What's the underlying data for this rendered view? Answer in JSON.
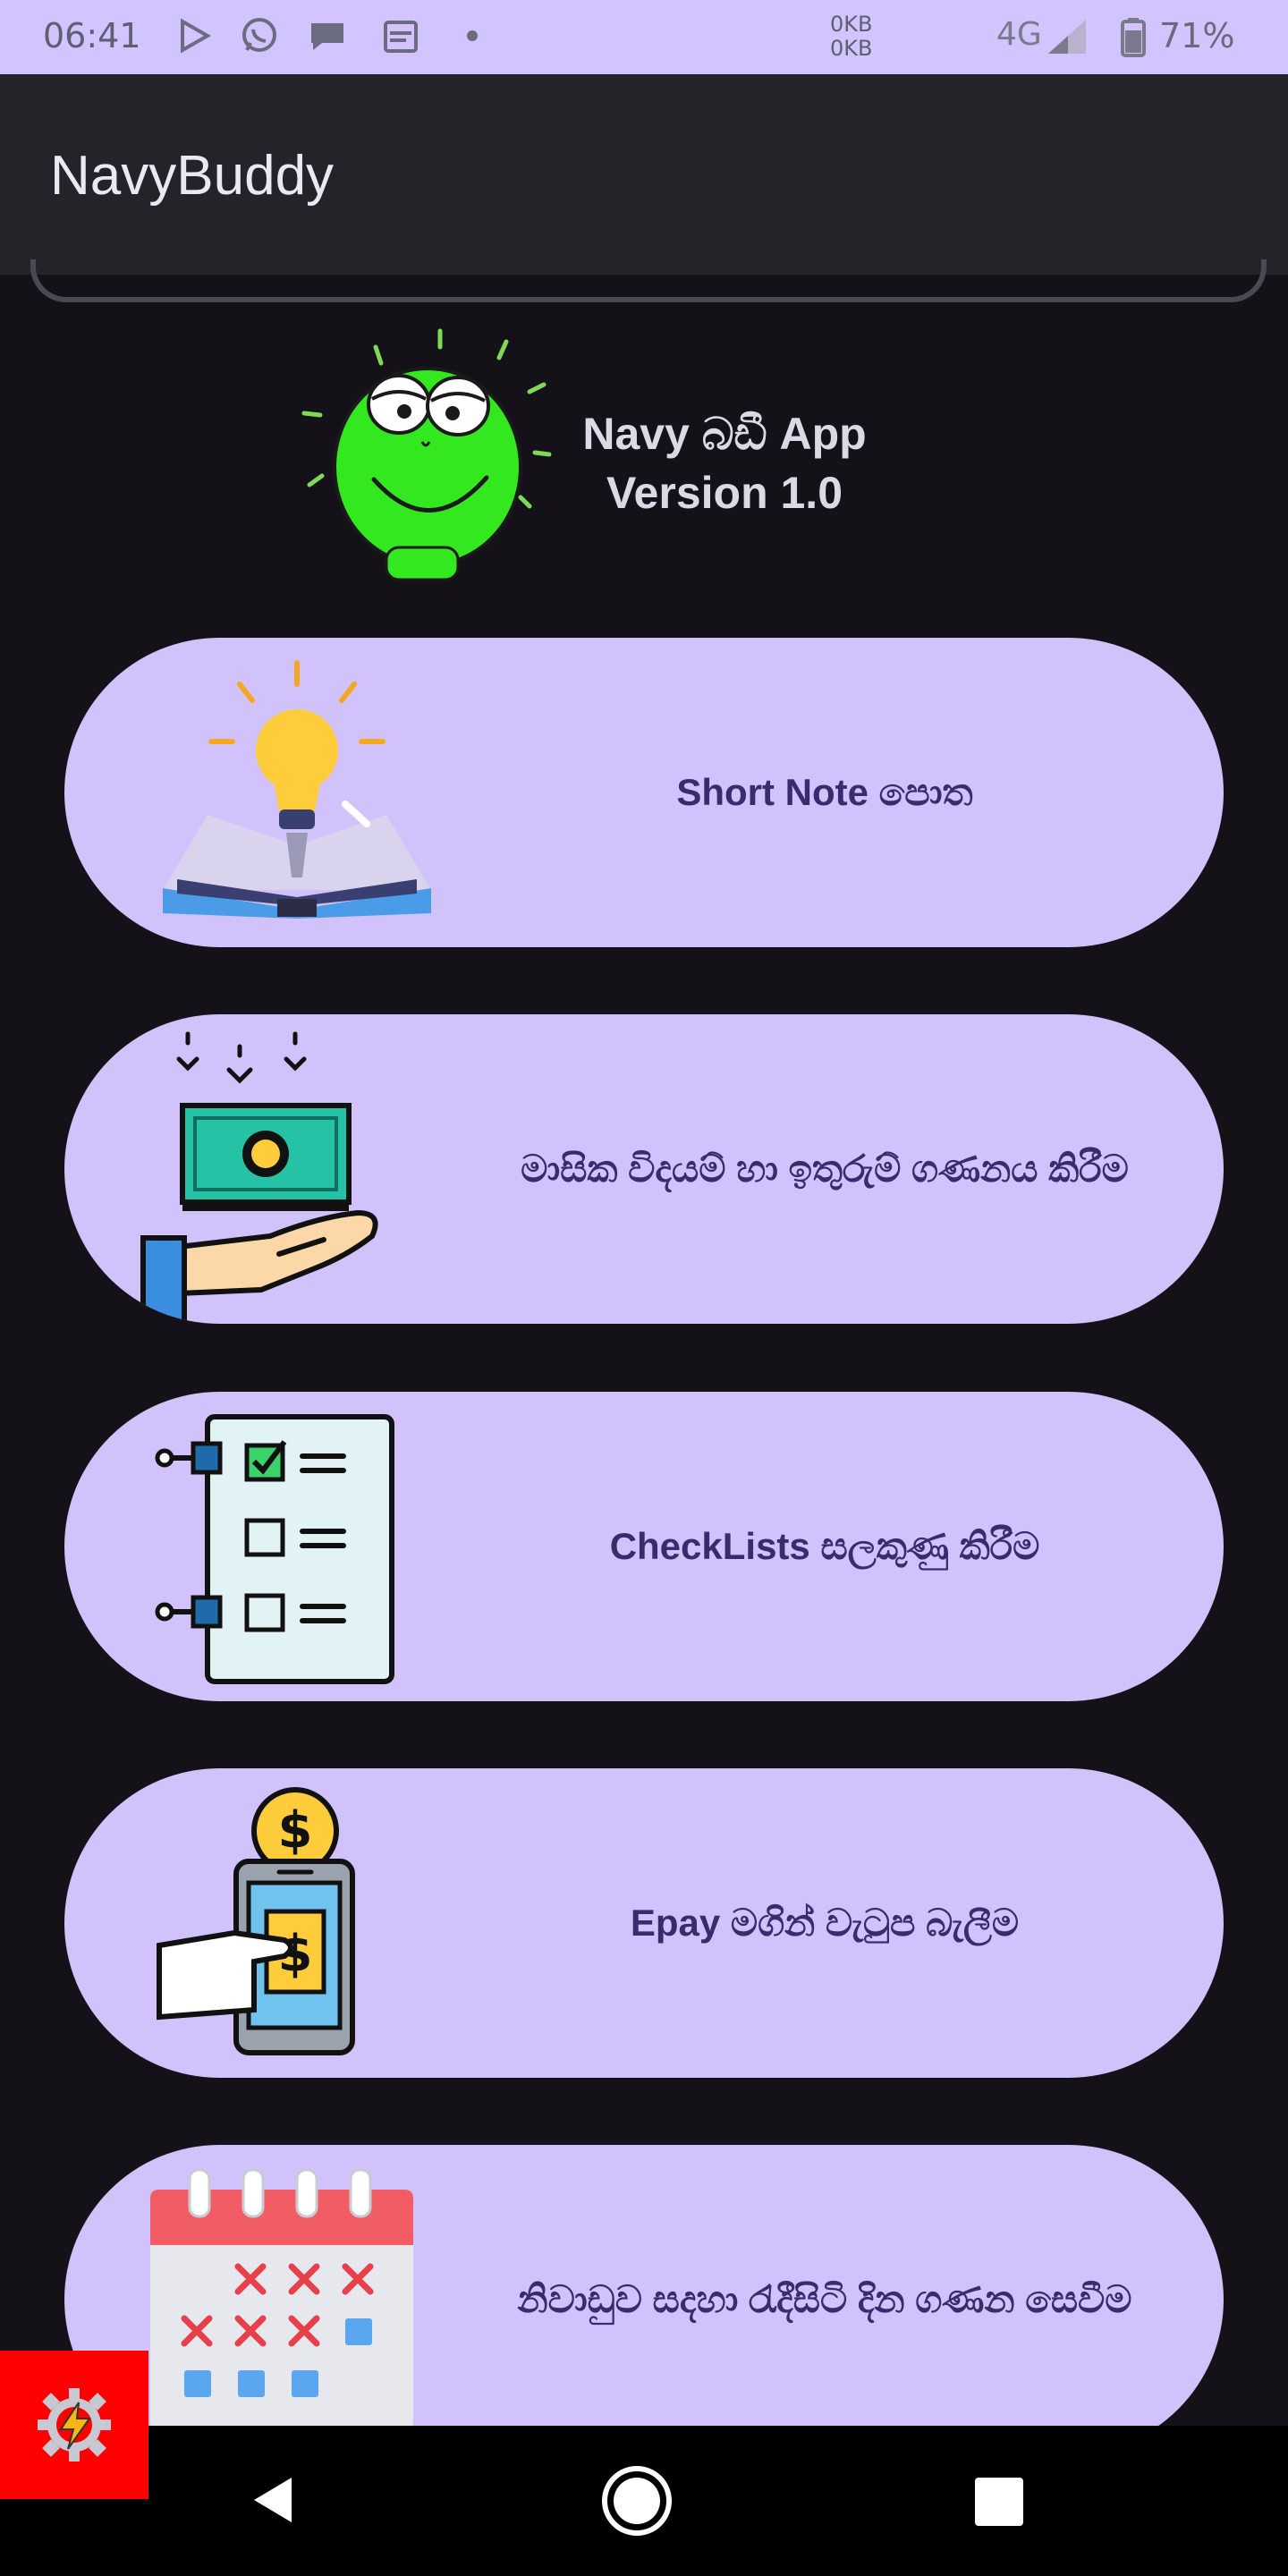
{
  "status_bar": {
    "time": "06:41",
    "kb_up": "0KB",
    "kb_down": "0KB",
    "network": "4G",
    "battery": "71%"
  },
  "app_bar": {
    "title": "NavyBuddy"
  },
  "header": {
    "app_name_line1": "Navy බඩී App",
    "app_name_line2": "Version 1.0"
  },
  "menu": [
    {
      "label": "Short Note පොත",
      "icon": "lightbulb-book-icon"
    },
    {
      "label": "මාසික විදයම් හා ඉතුරුම් ගණනය කිරීම",
      "icon": "money-hand-icon"
    },
    {
      "label": "CheckLists සලකුණු කිරීම",
      "icon": "checklist-icon"
    },
    {
      "label": "Epay මගින් වැටුප බැලීම",
      "icon": "mobile-payment-icon"
    },
    {
      "label": "නිවාඩුව සදහා රැදීසිටි දින ගණන සෙවීම",
      "icon": "calendar-icon"
    }
  ],
  "colors": {
    "status_bar": "#d1c4ff",
    "app_bar": "#25232a",
    "background": "#141218",
    "card": "#d1c2fc",
    "card_text": "#3b2b6e",
    "nav_bar": "#000000"
  }
}
